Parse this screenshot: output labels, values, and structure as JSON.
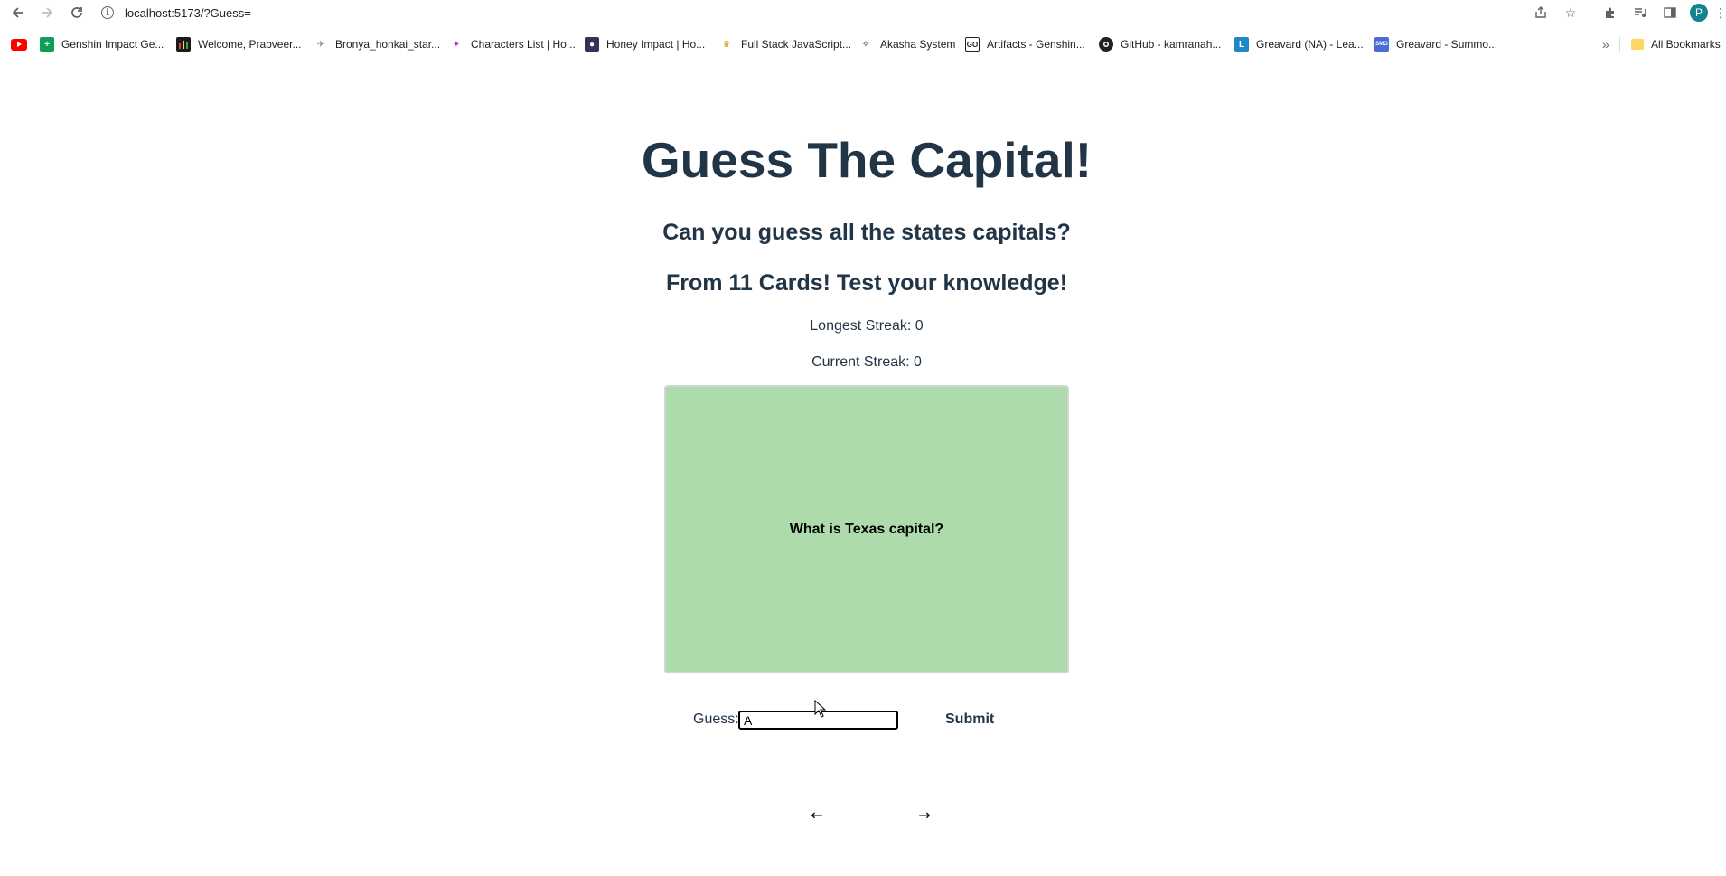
{
  "browser": {
    "url": "localhost:5173/?Guess=",
    "profile_initial": "P",
    "bookmarks": [
      {
        "label": "Genshin Impact Ge...",
        "icon": "sheets-icon",
        "color": "#0f9d58"
      },
      {
        "label": "Welcome, Prabveer...",
        "icon": "chart-favicon",
        "color": "#1b1b1b"
      },
      {
        "label": "Bronya_honkai_star...",
        "icon": "feather-icon",
        "color": "#888888"
      },
      {
        "label": "Characters List | Ho...",
        "icon": "honkai-icon",
        "color": "#a040c0"
      },
      {
        "label": "Honey Impact | Ho...",
        "icon": "honey-icon",
        "color": "#333355"
      },
      {
        "label": "Full Stack JavaScript...",
        "icon": "trophy-icon",
        "color": "#d4a017"
      },
      {
        "label": "Akasha System",
        "icon": "akasha-icon",
        "color": "#202124"
      },
      {
        "label": "Artifacts - Genshin...",
        "icon": "go-icon",
        "color": "#202124"
      },
      {
        "label": "GitHub - kamranah...",
        "icon": "github-icon",
        "color": "#202124"
      },
      {
        "label": "Greavard (NA) - Lea...",
        "icon": "l-icon",
        "color": "#1e88c7"
      },
      {
        "label": "Greavard - Summo...",
        "icon": "smogon-icon",
        "color": "#4a6cd4"
      }
    ],
    "all_bookmarks_label": "All Bookmarks"
  },
  "page": {
    "title": "Guess The Capital!",
    "subtitle": "Can you guess all the states capitals?",
    "cards_line": "From 11 Cards! Test your knowledge!",
    "longest_streak": "Longest Streak: 0",
    "current_streak": "Current Streak: 0",
    "card_question": "What is Texas capital?",
    "card_color": "#addbab",
    "guess_label": "Guess:",
    "guess_value": "A",
    "submit_label": "Submit",
    "prev_label": "←",
    "next_label": "→"
  }
}
